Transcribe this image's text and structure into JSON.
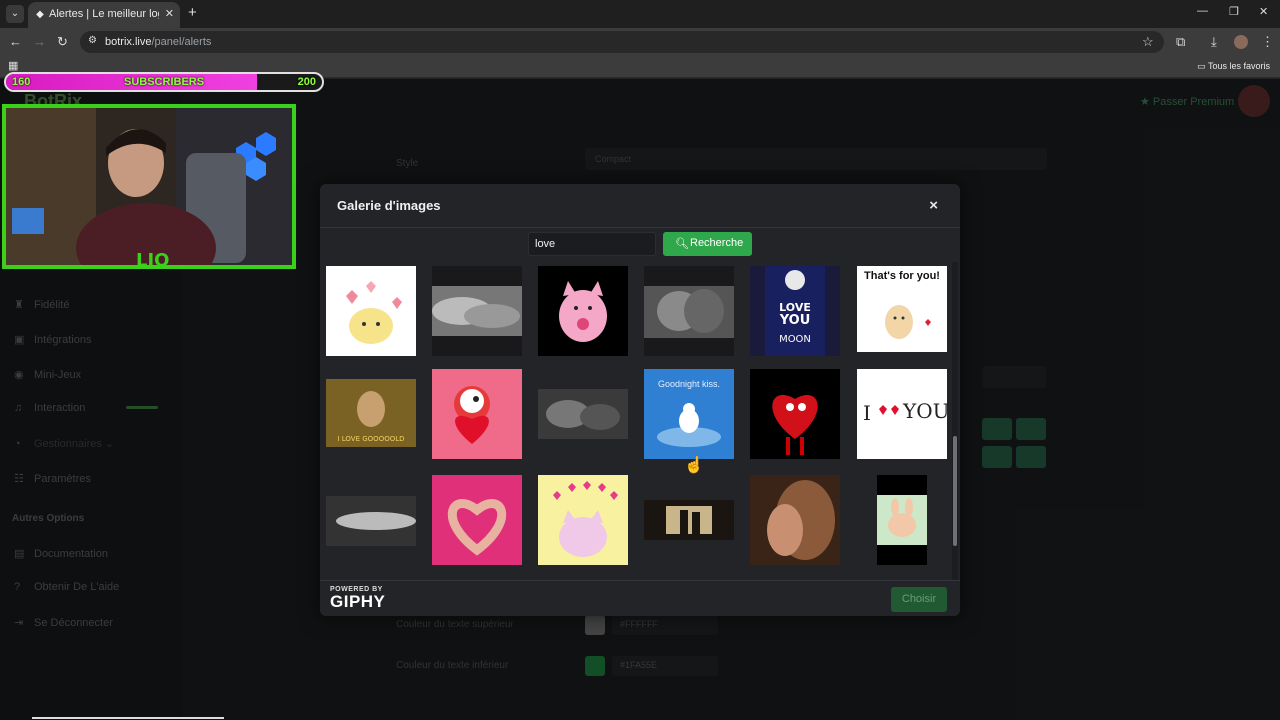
{
  "browser": {
    "tab_title": "Alertes | Le meilleur logiciel pour",
    "tab_close": "✕",
    "new_tab": "+",
    "url_host": "botrix.live",
    "url_path": "/panel/alerts",
    "bookmarks_label": "Tous les favoris",
    "win_minimize": "—",
    "win_restore": "❐",
    "win_close": "✕"
  },
  "overlay": {
    "sub_min": "160",
    "sub_label": "SUBSCRIBERS",
    "sub_max": "200",
    "sub_progress": 0.795
  },
  "page_bg": {
    "brand": "BotRix",
    "premium": "★ Passer Premium",
    "style_label": "Style",
    "style_value": "Compact",
    "sidebar_items": [
      "Fidélité",
      "Intégrations",
      "Mini-Jeux",
      "Interaction",
      "Gestionnaires",
      "Paramètres"
    ],
    "section_label": "Autres Options",
    "other_items": [
      "Documentation",
      "Obtenir De L'aide",
      "Se Déconnecter"
    ],
    "top_text_label": "Couleur du texte supérieur",
    "top_text_value": "#FFFFFF",
    "bottom_text_label": "Couleur du texte inférieur",
    "bottom_text_value": "#1FA55E"
  },
  "modal": {
    "title": "Galerie d'images",
    "close": "×",
    "search_value": "love",
    "search_button": "Recherche",
    "powered_by": "POWERED BY",
    "giphy": "GIPHY",
    "choose_button": "Choisir"
  },
  "gifs": {
    "g4_text": "That's for you!",
    "g6_text": "Goodnight kiss.",
    "g2_text": "LOVE YOU TO THE MOON",
    "g7_text": "I LOVE GOOOOOLD",
    "g8_i": "I",
    "g8_you": "YOU"
  },
  "colors": {
    "accent": "#2ea84a",
    "overlay_green": "#3bd11a",
    "sub_pink": "#d81bc0"
  }
}
